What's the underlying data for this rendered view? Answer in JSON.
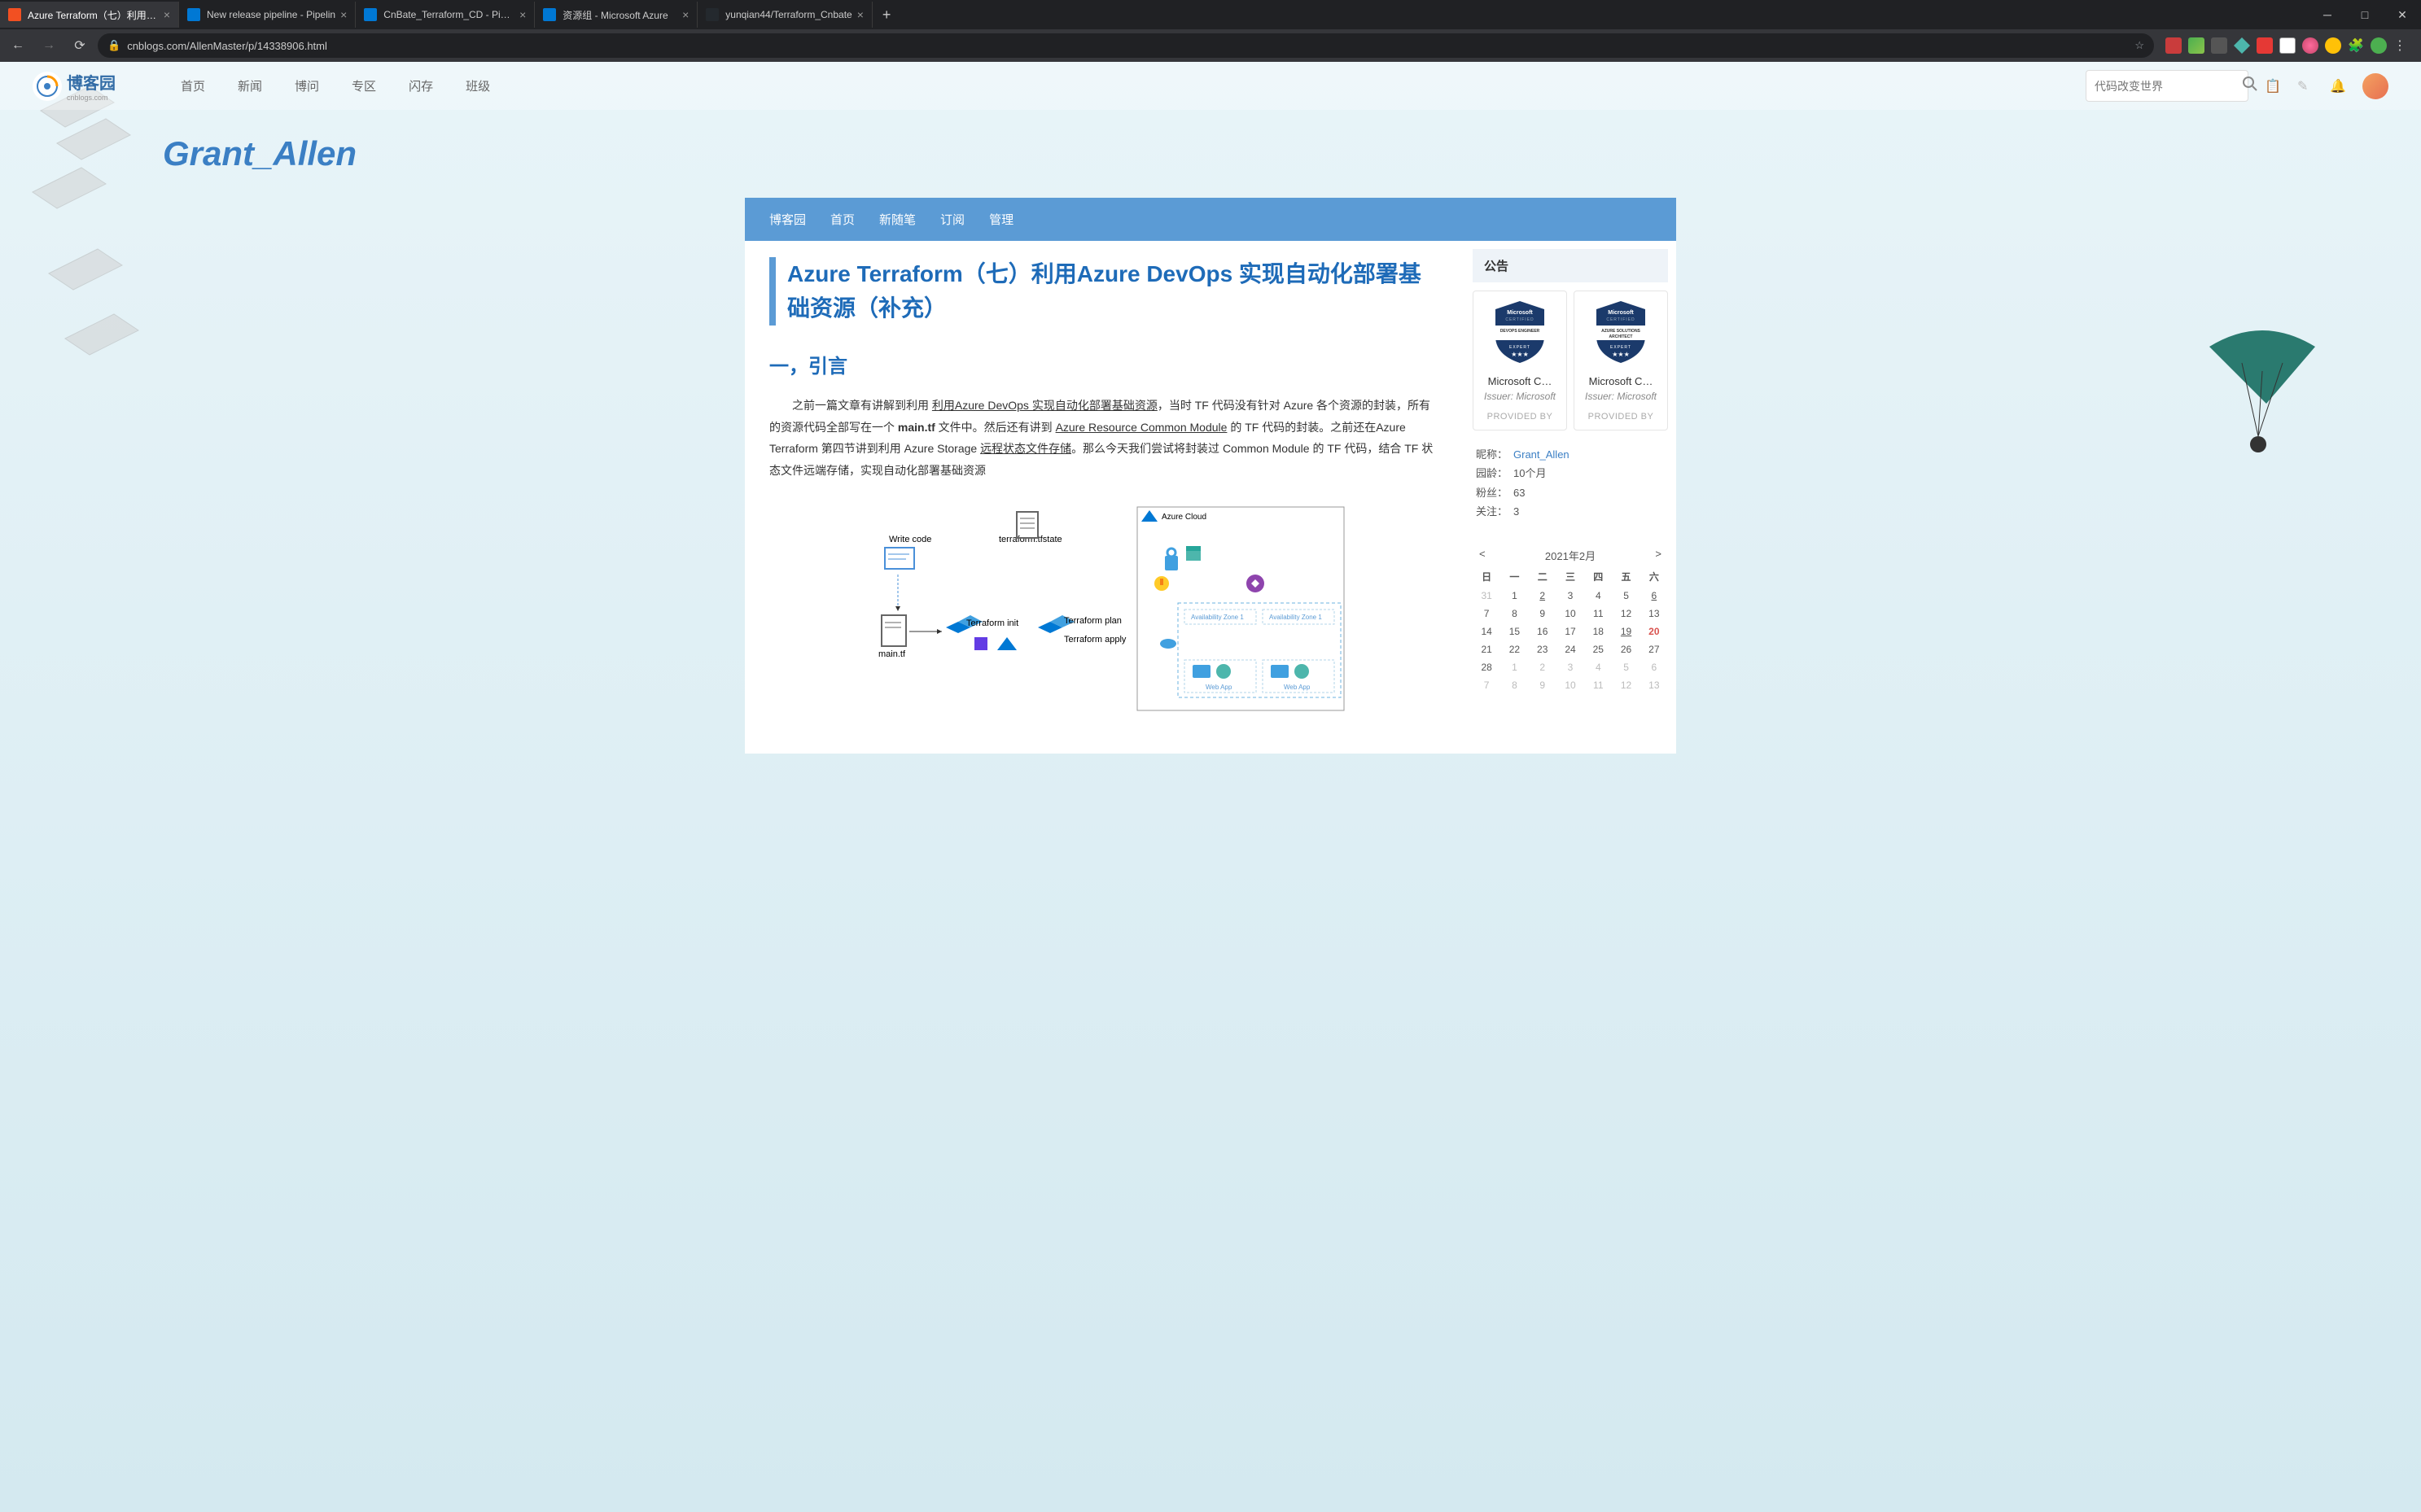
{
  "browser": {
    "tabs": [
      {
        "title": "Azure Terraform（七）利用Azu",
        "favicon": "#f25022",
        "active": true
      },
      {
        "title": "New release pipeline - Pipelin",
        "favicon": "#0078d4",
        "active": false
      },
      {
        "title": "CnBate_Terraform_CD - Pipeli",
        "favicon": "#0078d4",
        "active": false
      },
      {
        "title": "资源组 - Microsoft Azure",
        "favicon": "#0078d4",
        "active": false
      },
      {
        "title": "yunqian44/Terraform_Cnbate",
        "favicon": "#24292e",
        "active": false
      }
    ],
    "url": "cnblogs.com/AllenMaster/p/14338906.html"
  },
  "topnav": {
    "logo": "博客园",
    "logo_sub": "cnblogs.com",
    "links": [
      "首页",
      "新闻",
      "博问",
      "专区",
      "闪存",
      "班级"
    ],
    "search_placeholder": "代码改变世界"
  },
  "blog": {
    "title": "Grant_Allen",
    "subnav": [
      "博客园",
      "首页",
      "新随笔",
      "订阅",
      "管理"
    ]
  },
  "article": {
    "title": "Azure Terraform（七）利用Azure DevOps 实现自动化部署基础资源（补充）",
    "section1": "一，引言",
    "p1_pre": "之前一篇文章有讲解到利用 ",
    "p1_link1": "利用Azure DevOps 实现自动化部署基础资源",
    "p1_mid1": "，当时 TF 代码没有针对 Azure 各个资源的封装，所有的资源代码全部写在一个 ",
    "p1_bold": "main.tf",
    "p1_mid2": " 文件中。然后还有讲到 ",
    "p1_link2": "Azure Resource Common Module",
    "p1_mid3": " 的 TF 代码的封装。之前还在Azure Terraform 第四节讲到利用 Azure Storage ",
    "p1_link3": "远程状态文件存储",
    "p1_post": "。那么今天我们尝试将封装过 Common Module 的 TF 代码，结合 TF 状态文件远端存储，实现自动化部署基础资源",
    "diagram": {
      "write_code": "Write code",
      "tfstate": "terraform.tfstate",
      "maintf": "main.tf",
      "tf_init": "Terraform init",
      "tf_plan": "Terraform plan",
      "tf_apply": "Terraform apply",
      "azure_cloud": "Azure Cloud",
      "az1": "Availability Zone 1",
      "az2": "Availability Zone 1",
      "webapp": "Web App"
    }
  },
  "sidebar": {
    "announce": "公告",
    "badges": [
      {
        "top": "Microsoft",
        "cert": "CERTIFIED",
        "mid": "DEVOPS ENGINEER",
        "level": "EXPERT",
        "name": "Microsoft C…",
        "issuer": "Issuer: Microsoft",
        "prov": "PROVIDED BY"
      },
      {
        "top": "Microsoft",
        "cert": "CERTIFIED",
        "mid": "AZURE SOLUTIONS ARCHITECT",
        "level": "EXPERT",
        "name": "Microsoft C…",
        "issuer": "Issuer: Microsoft",
        "prov": "PROVIDED BY"
      }
    ],
    "profile": {
      "nick_label": "昵称：",
      "nick": "Grant_Allen",
      "age_label": "园龄：",
      "age": "10个月",
      "fans_label": "粉丝：",
      "fans": "63",
      "follow_label": "关注：",
      "follow": "3"
    },
    "calendar": {
      "prev": "<",
      "title": "2021年2月",
      "next": ">",
      "dow": [
        "日",
        "一",
        "二",
        "三",
        "四",
        "五",
        "六"
      ],
      "weeks": [
        [
          {
            "d": "31",
            "o": true
          },
          {
            "d": "1"
          },
          {
            "d": "2",
            "l": true
          },
          {
            "d": "3"
          },
          {
            "d": "4"
          },
          {
            "d": "5"
          },
          {
            "d": "6",
            "l": true
          }
        ],
        [
          {
            "d": "7"
          },
          {
            "d": "8"
          },
          {
            "d": "9"
          },
          {
            "d": "10"
          },
          {
            "d": "11"
          },
          {
            "d": "12"
          },
          {
            "d": "13"
          }
        ],
        [
          {
            "d": "14"
          },
          {
            "d": "15"
          },
          {
            "d": "16"
          },
          {
            "d": "17"
          },
          {
            "d": "18"
          },
          {
            "d": "19",
            "l": true
          },
          {
            "d": "20",
            "t": true
          }
        ],
        [
          {
            "d": "21"
          },
          {
            "d": "22"
          },
          {
            "d": "23"
          },
          {
            "d": "24"
          },
          {
            "d": "25"
          },
          {
            "d": "26"
          },
          {
            "d": "27"
          }
        ],
        [
          {
            "d": "28"
          },
          {
            "d": "1",
            "o": true
          },
          {
            "d": "2",
            "o": true
          },
          {
            "d": "3",
            "o": true
          },
          {
            "d": "4",
            "o": true
          },
          {
            "d": "5",
            "o": true
          },
          {
            "d": "6",
            "o": true
          }
        ],
        [
          {
            "d": "7",
            "o": true
          },
          {
            "d": "8",
            "o": true
          },
          {
            "d": "9",
            "o": true
          },
          {
            "d": "10",
            "o": true
          },
          {
            "d": "11",
            "o": true
          },
          {
            "d": "12",
            "o": true
          },
          {
            "d": "13",
            "o": true
          }
        ]
      ]
    }
  }
}
